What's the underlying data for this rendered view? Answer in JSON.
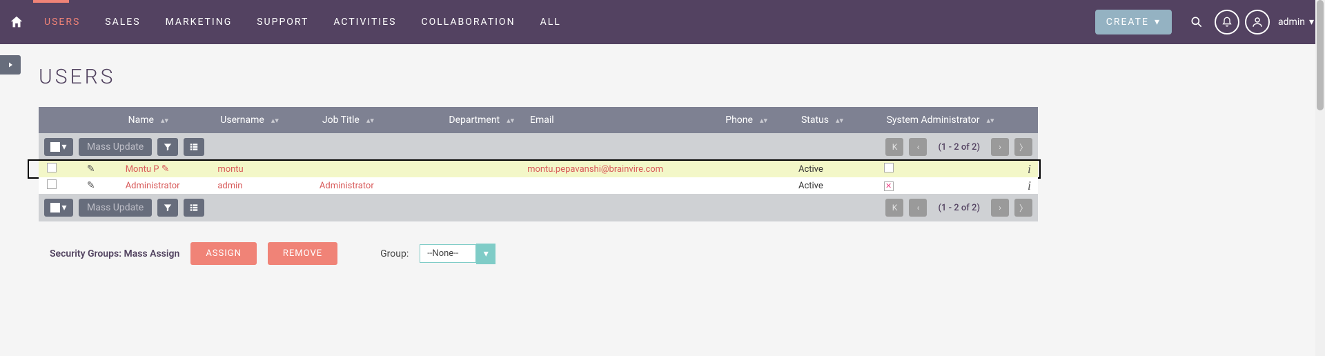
{
  "nav": {
    "items": [
      {
        "label": "USERS",
        "active": true
      },
      {
        "label": "SALES"
      },
      {
        "label": "MARKETING"
      },
      {
        "label": "SUPPORT"
      },
      {
        "label": "ACTIVITIES"
      },
      {
        "label": "COLLABORATION"
      },
      {
        "label": "ALL"
      }
    ],
    "create": "CREATE",
    "user": "admin"
  },
  "page": {
    "title": "USERS"
  },
  "columns": {
    "name": "Name",
    "username": "Username",
    "job": "Job Title",
    "dept": "Department",
    "email": "Email",
    "phone": "Phone",
    "status": "Status",
    "sys": "System Administrator"
  },
  "toolbar": {
    "mass_update": "Mass Update",
    "pager": "(1 - 2 of 2)"
  },
  "rows": [
    {
      "name": "Montu P",
      "username": "montu",
      "job": "",
      "dept": "",
      "email": "montu.pepavanshi@brainvire.com",
      "phone": "",
      "status": "Active",
      "sys": false,
      "highlight": true
    },
    {
      "name": "Administrator",
      "username": "admin",
      "job": "Administrator",
      "dept": "",
      "email": "",
      "phone": "",
      "status": "Active",
      "sys": true,
      "highlight": false
    }
  ],
  "mass": {
    "title": "Security Groups: Mass Assign",
    "assign": "ASSIGN",
    "remove": "REMOVE",
    "group_label": "Group:",
    "group_selected": "--None--"
  }
}
